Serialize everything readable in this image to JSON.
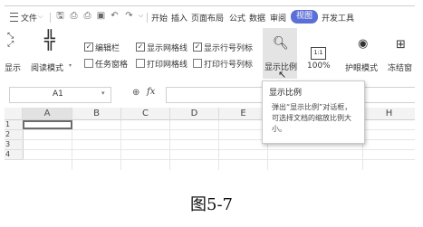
{
  "menubar": {
    "file_label": "文件",
    "tabs": [
      "开始",
      "插入",
      "页面布局",
      "公式",
      "数据",
      "审阅",
      "视图",
      "开发工具"
    ],
    "active_tab": "视图",
    "accent_color": "#5b6fd6"
  },
  "ribbon": {
    "normal_label": "显示",
    "reading_mode_label": "阅读模式",
    "checkboxes": [
      {
        "label": "编辑栏",
        "checked": true
      },
      {
        "label": "显示网格线",
        "checked": true
      },
      {
        "label": "显示行号列标",
        "checked": true
      },
      {
        "label": "任务窗格",
        "checked": false
      },
      {
        "label": "打印网格线",
        "checked": false
      },
      {
        "label": "打印行号列标",
        "checked": false
      }
    ],
    "zoom_label": "显示比例",
    "zoom_100_label": "100%",
    "zoom_100_icon_text": "1:1",
    "eye_protect_label": "护眼模式",
    "freeze_label": "冻结窗"
  },
  "tooltip": {
    "title": "显示比例",
    "body": "弹出“显示比例”对话框，可选择文档的缩放比例大小。"
  },
  "formula_bar": {
    "name_box": "A1",
    "fx_label": "fx"
  },
  "grid": {
    "columns": [
      "A",
      "B",
      "C",
      "D",
      "E",
      "H"
    ],
    "rows": [
      "1",
      "2",
      "3",
      "4"
    ]
  },
  "caption": "图5-7"
}
